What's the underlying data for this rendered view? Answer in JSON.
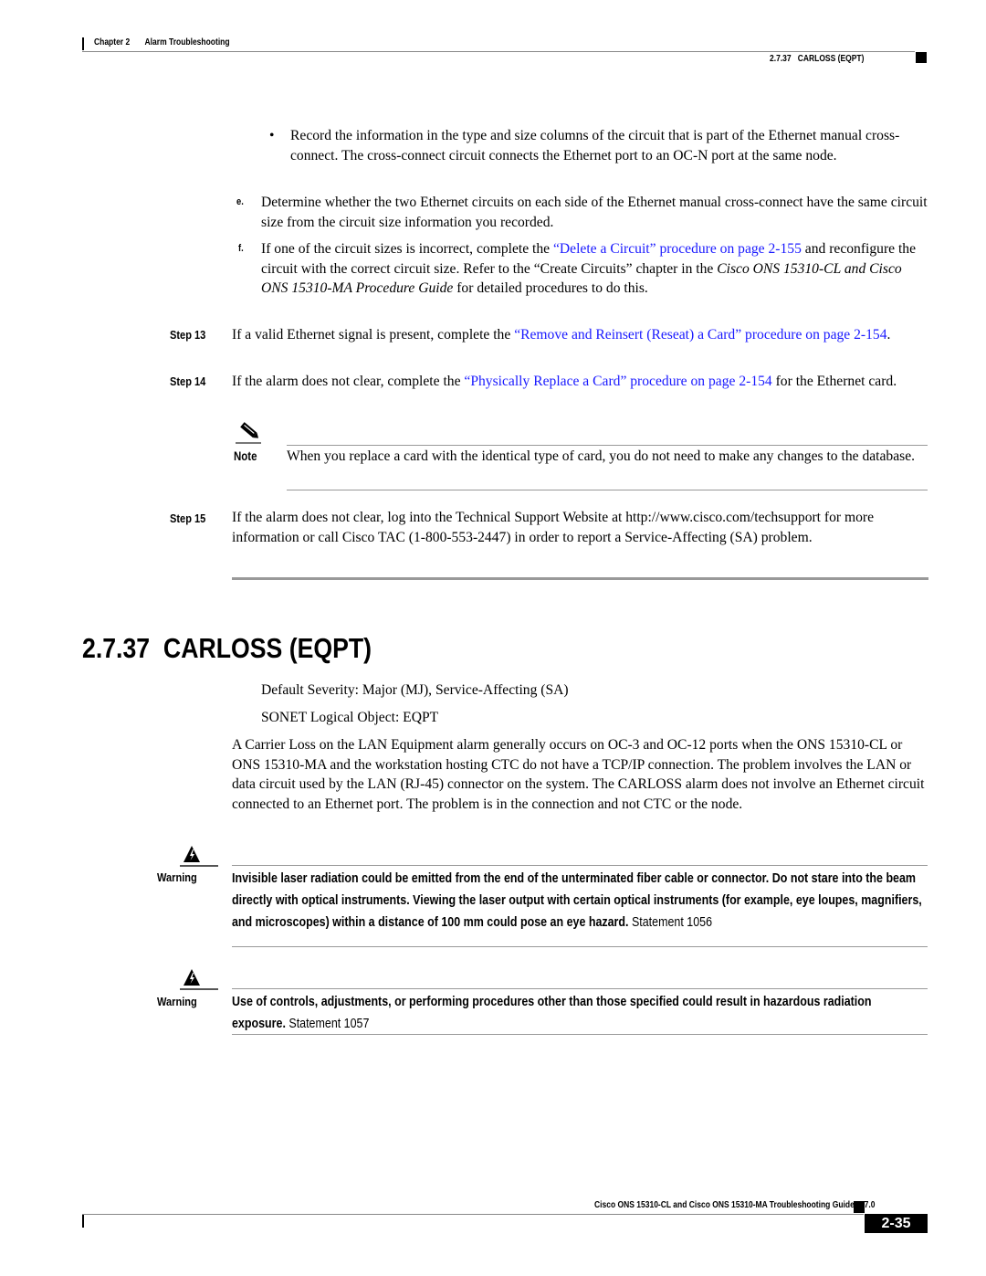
{
  "header": {
    "chapter": "Chapter 2",
    "chapter_title": "Alarm Troubleshooting",
    "section_ref": "2.7.37   CARLOSS (EQPT)"
  },
  "steps_top": {
    "bullet": {
      "symbol": "•",
      "text": "Record the information in the type and size columns of the circuit that is part of the Ethernet manual cross-connect. The cross-connect circuit connects the Ethernet port to an OC-N port at the same node."
    },
    "item_e": {
      "label": "e.",
      "text": "Determine whether the two Ethernet circuits on each side of the Ethernet manual cross-connect have the same circuit size from the circuit size information you recorded."
    },
    "item_f": {
      "label": "f.",
      "text_before": "If one of the circuit sizes is incorrect, complete the ",
      "link": "“Delete a Circuit” procedure on page 2-155",
      "text_after": " and reconfigure the circuit with the correct circuit size. Refer to the “Create Circuits” chapter in the ",
      "italic": "Cisco ONS 15310-CL and Cisco ONS 15310-MA Procedure Guide",
      "text_end": " for detailed procedures to do this."
    },
    "step13": {
      "label": "Step 13",
      "text_before": "If a valid Ethernet signal is present, complete the ",
      "link": "“Remove and Reinsert (Reseat) a Card” procedure on page 2-154",
      "text_after": "."
    },
    "step14": {
      "label": "Step 14",
      "text_before": "If the alarm does not clear, complete the ",
      "link": "“Physically Replace a Card” procedure on page 2-154",
      "text_after": " for the Ethernet card."
    },
    "note": {
      "icon": "pencil-note-icon",
      "label": "Note",
      "text": "When you replace a card with the identical type of card, you do not need to make any changes to the database."
    },
    "step15": {
      "label": "Step 15",
      "text": "If the alarm does not clear, log into the Technical Support Website at http://www.cisco.com/techsupport for more information or call Cisco TAC (1-800-553-2447) in order to report a Service-Affecting (SA) problem."
    }
  },
  "section": {
    "title": "2.7.37  CARLOSS (EQPT)",
    "severity": "Default Severity: Major (MJ), Service-Affecting (SA)",
    "logical_object": "SONET Logical Object: EQPT",
    "description": "A Carrier Loss on the LAN Equipment alarm generally occurs on OC-3 and OC-12 ports when the ONS 15310-CL or ONS 15310-MA and the workstation hosting CTC do not have a TCP/IP connection. The problem involves the LAN or data circuit used by the LAN (RJ-45) connector on the system. The CARLOSS alarm does not involve an Ethernet circuit connected to an Ethernet port. The problem is in the connection and not CTC or the node."
  },
  "warnings": [
    {
      "icon": "warning-triangle-icon",
      "label": "Warning",
      "bold": "Invisible laser radiation could be emitted from the end of the unterminated fiber cable or connector. Do not stare into the beam directly with optical instruments. Viewing the laser output with certain optical instruments (for example, eye loupes, magnifiers, and microscopes) within a distance of 100 mm could pose an eye hazard.",
      "statement": " Statement 1056"
    },
    {
      "icon": "warning-triangle-icon",
      "label": "Warning",
      "bold": "Use of controls, adjustments, or performing procedures other than those specified could result in hazardous radiation exposure.",
      "statement": " Statement 1057"
    }
  ],
  "footer": {
    "guide_title": "Cisco ONS 15310-CL and Cisco ONS 15310-MA Troubleshooting Guide, R7.0",
    "page_number": "2-35"
  },
  "colors": {
    "link": "#1a1aff",
    "rule": "#999999",
    "text": "#000000"
  }
}
